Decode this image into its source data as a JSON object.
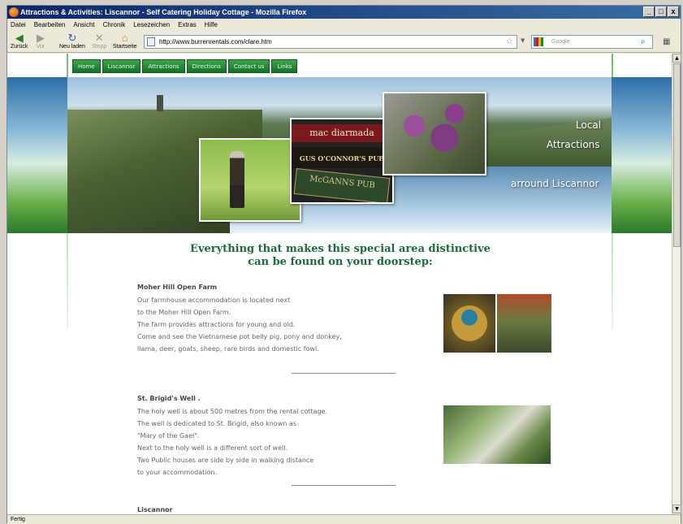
{
  "window": {
    "title": "Attractions & Activities: Liscannor - Self Catering Holiday Cottage - Mozilla Firefox",
    "buttons": [
      "_",
      "□",
      "x"
    ]
  },
  "menu": [
    "Datei",
    "Bearbeiten",
    "Ansicht",
    "Chronik",
    "Lesezeichen",
    "Extras",
    "Hilfe"
  ],
  "toolbar": {
    "back": "Zurück",
    "forward": "Vor",
    "reload": "Neu laden",
    "stop": "Stopp",
    "home": "Startseite",
    "url": "http://www.burrenrentals.com/clare.htm",
    "search_placeholder": "Google"
  },
  "status": "Fertig",
  "site": {
    "nav": [
      "Home",
      "Liscannor",
      "Attractions",
      "Directions",
      "Contact us",
      "Links"
    ],
    "banner": {
      "line1": "Local",
      "line2": "Attractions",
      "line3": "arround Liscannor",
      "pub_sign1": "mac diarmada",
      "pub_sign2": "GUS O'CONNOR'S PUB",
      "pub_sign3": "McGANNS PUB"
    },
    "heading_line1": "Everything that makes this special area distinctive",
    "heading_line2": "can be found on your doorstep:",
    "sections": [
      {
        "title": "Moher Hill Open Farm",
        "lines": [
          "Our farmhouse accommodation is located next",
          "to the Moher Hill Open Farm.",
          "The farm provides attractions for young and old.",
          "Come and see the Vietnamese pot belly pig, pony and donkey,",
          "llama, deer, goats, sheep, rare birds and domestic fowl."
        ]
      },
      {
        "title": "St. Brigid's Well .",
        "lines": [
          "The holy well is about 500 metres from the rental cottage.",
          "The well is dedicated to St. Brigid, also known as",
          "\"Mary of the Gael\".",
          "Next to the holy well is a different sort of well.",
          "Two Public houses are side by side in walking distance",
          "to your accommodation."
        ]
      },
      {
        "title": "Liscannor",
        "lines": []
      }
    ]
  }
}
